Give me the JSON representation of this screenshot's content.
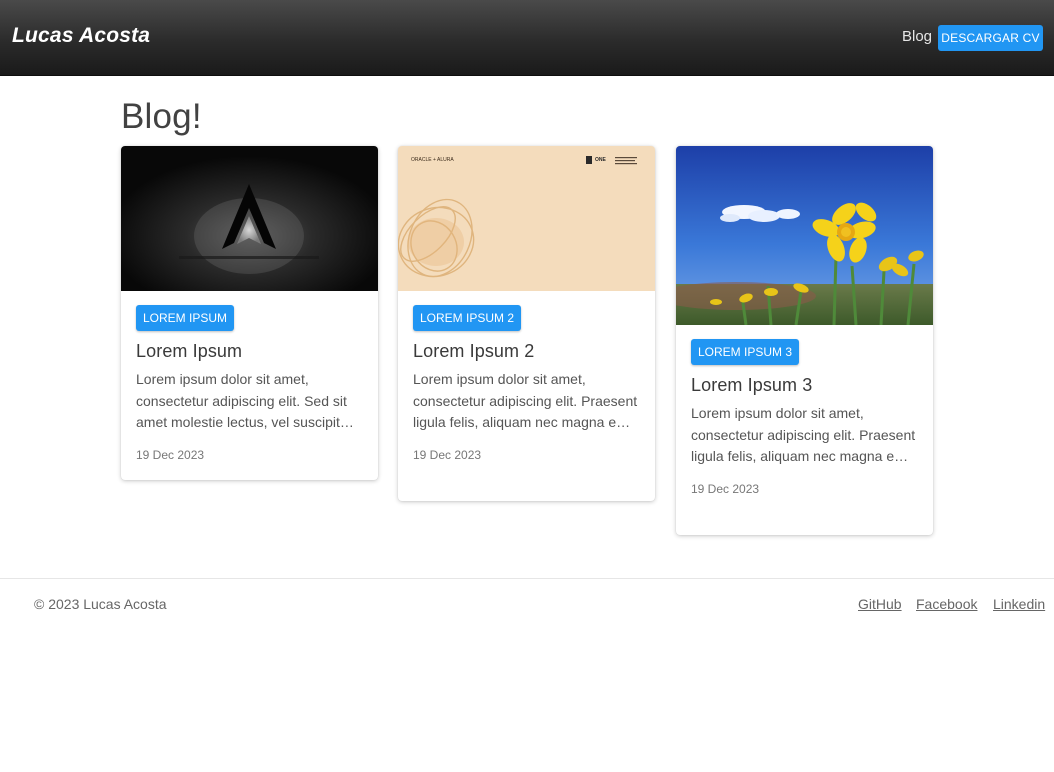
{
  "header": {
    "brand": "Lucas Acosta",
    "nav_blog": "Blog",
    "cv_button": "DESCARGAR CV"
  },
  "main": {
    "heading": "Blog!",
    "cards": [
      {
        "tag": "LOREM IPSUM",
        "title": "Lorem Ipsum",
        "text": "Lorem ipsum dolor sit amet, consectetur adipiscing elit. Sed sit amet molestie lectus, vel suscipit…",
        "date": "19 Dec 2023",
        "image": "assassins-creed-logo-dark"
      },
      {
        "tag": "LOREM IPSUM 2",
        "title": "Lorem Ipsum 2",
        "text": "Lorem ipsum dolor sit amet, consectetur adipiscing elit. Praesent ligula felis, aliquam nec magna e…",
        "date": "19 Dec 2023",
        "image": "oracle-one-beige-banner",
        "image_texts": {
          "oracle": "ORACLE + ALURA",
          "one": "ONE",
          "one_sub": "Oracle Next Education"
        }
      },
      {
        "tag": "LOREM IPSUM 3",
        "title": "Lorem Ipsum 3",
        "text": "Lorem ipsum dolor sit amet, consectetur adipiscing elit. Praesent ligula felis, aliquam nec magna e…",
        "date": "19 Dec 2023",
        "image": "yellow-daffodils-blue-sky"
      }
    ]
  },
  "footer": {
    "copyright": "© 2023 Lucas Acosta",
    "links": [
      "GitHub",
      "Facebook",
      "Linkedin"
    ]
  },
  "colors": {
    "accent": "#2196f3",
    "navbar": "#2b2b2b",
    "text": "#424242"
  }
}
